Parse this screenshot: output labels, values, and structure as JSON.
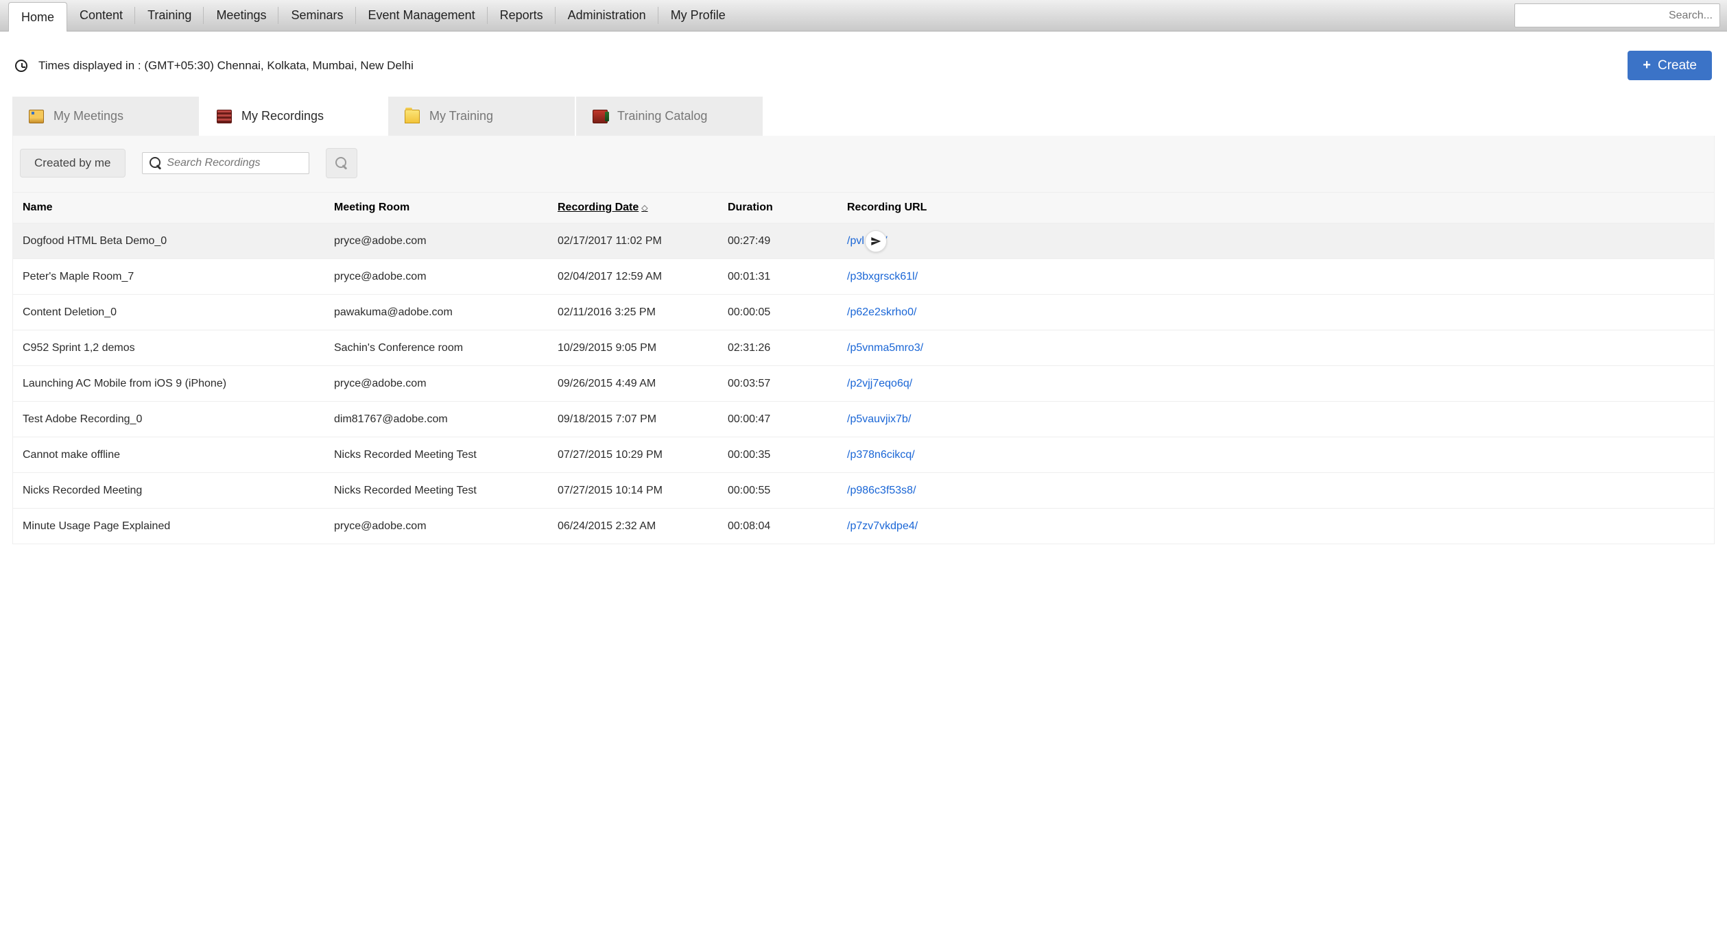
{
  "topnav": {
    "items": [
      {
        "label": "Home",
        "active": true
      },
      {
        "label": "Content",
        "active": false
      },
      {
        "label": "Training",
        "active": false
      },
      {
        "label": "Meetings",
        "active": false
      },
      {
        "label": "Seminars",
        "active": false
      },
      {
        "label": "Event Management",
        "active": false
      },
      {
        "label": "Reports",
        "active": false
      },
      {
        "label": "Administration",
        "active": false
      },
      {
        "label": "My Profile",
        "active": false
      }
    ],
    "search_placeholder": "Search..."
  },
  "subhead": {
    "tz_text": "Times displayed in : (GMT+05:30) Chennai, Kolkata, Mumbai, New Delhi",
    "create_label": "Create"
  },
  "seg_tabs": [
    {
      "label": "My Meetings",
      "icon": "icon-meetings",
      "active": false
    },
    {
      "label": "My Recordings",
      "icon": "icon-recordings",
      "active": true
    },
    {
      "label": "My Training",
      "icon": "icon-training",
      "active": false
    },
    {
      "label": "Training Catalog",
      "icon": "icon-catalog",
      "active": false
    }
  ],
  "filters": {
    "created_by_me_label": "Created by me",
    "search_placeholder": "Search Recordings"
  },
  "table": {
    "columns": {
      "name": "Name",
      "meeting_room": "Meeting Room",
      "recording_date": "Recording Date",
      "duration": "Duration",
      "recording_url": "Recording URL"
    },
    "rows": [
      {
        "name": "Dogfood HTML Beta Demo_0",
        "room": "pryce@adobe.com",
        "date": "02/17/2017 11:02 PM",
        "dur": "00:27:49",
        "url": "/pvl       oitx/",
        "hovered": true,
        "action": true
      },
      {
        "name": "Peter's Maple Room_7",
        "room": "pryce@adobe.com",
        "date": "02/04/2017 12:59 AM",
        "dur": "00:01:31",
        "url": "/p3bxgrsck61l/"
      },
      {
        "name": "Content Deletion_0",
        "room": "pawakuma@adobe.com",
        "date": "02/11/2016 3:25 PM",
        "dur": "00:00:05",
        "url": "/p62e2skrho0/"
      },
      {
        "name": "C952 Sprint 1,2 demos",
        "room": "Sachin's Conference room",
        "date": "10/29/2015 9:05 PM",
        "dur": "02:31:26",
        "url": "/p5vnma5mro3/"
      },
      {
        "name": "Launching AC Mobile from iOS 9 (iPhone)",
        "room": "pryce@adobe.com",
        "date": "09/26/2015 4:49 AM",
        "dur": "00:03:57",
        "url": "/p2vjj7eqo6q/"
      },
      {
        "name": "Test Adobe Recording_0",
        "room": "dim81767@adobe.com",
        "date": "09/18/2015 7:07 PM",
        "dur": "00:00:47",
        "url": "/p5vauvjix7b/"
      },
      {
        "name": "Cannot make offline",
        "room": "Nicks Recorded Meeting Test",
        "date": "07/27/2015 10:29 PM",
        "dur": "00:00:35",
        "url": "/p378n6cikcq/"
      },
      {
        "name": "Nicks Recorded Meeting",
        "room": "Nicks Recorded Meeting Test",
        "date": "07/27/2015 10:14 PM",
        "dur": "00:00:55",
        "url": "/p986c3f53s8/"
      },
      {
        "name": "Minute Usage Page Explained",
        "room": "pryce@adobe.com",
        "date": "06/24/2015 2:32 AM",
        "dur": "00:08:04",
        "url": "/p7zv7vkdpe4/"
      }
    ]
  }
}
